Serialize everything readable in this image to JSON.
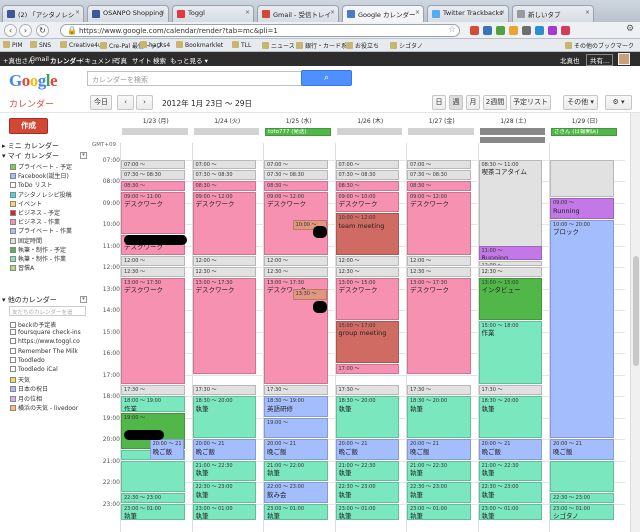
{
  "browser": {
    "tabs": [
      {
        "label": "(2) 「アシタノレシ",
        "color": "#3b5998",
        "active": false
      },
      {
        "label": "OSANPO Shopping",
        "color": "#3b5998",
        "active": false
      },
      {
        "label": "Toggl",
        "color": "#e0393e",
        "active": false
      },
      {
        "label": "Gmail - 受信トレイ",
        "color": "#d14836",
        "active": false
      },
      {
        "label": "Google カレンダー",
        "color": "#4d79c6",
        "active": true
      },
      {
        "label": "Twitter Trackbacks",
        "color": "#55acee",
        "active": false
      },
      {
        "label": "新しいタブ",
        "color": "#999999",
        "active": false
      }
    ],
    "url": "https://www.google.com/calendar/render?tab=mc&pli=1",
    "bookmarks": [
      "PIM",
      "SNS",
      "Creative4u",
      "Cre-Pal 最優トップ",
      "hacks4",
      "Bookmarklet",
      "TLL",
      "ニュース",
      "銀行・カード系",
      "お役立ち",
      "シゴタノ"
    ],
    "other_bookmarks": "その他のブックマーク"
  },
  "gbar": {
    "items": [
      "+真也さん",
      "Gmail",
      "カレンダー",
      "ドキュメント",
      "写真",
      "サイト",
      "検索",
      "もっと見る ▾"
    ],
    "user": "北真也",
    "share": "共有..."
  },
  "header": {
    "logo": "Google",
    "search_placeholder": "カレンダーを検索"
  },
  "toolbar": {
    "title": "カレンダー",
    "today": "今日",
    "prev": "‹",
    "next": "›",
    "range": "2012年 1月 23日 ～ 29日",
    "views": [
      "日",
      "週",
      "月",
      "2週間",
      "予定リスト"
    ],
    "selected_view": "週",
    "more": "その他 ▾",
    "settings": "⚙ ▾"
  },
  "sidebar": {
    "create": "作成",
    "mini_calendar": "▸ ミニ カレンダー",
    "my_calendars": "▾ マイ カレンダー",
    "my": [
      {
        "name": "プライベート - 予定",
        "color": "#7bd148"
      },
      {
        "name": "Facebook(誕生日)",
        "color": "#a4bdfc"
      },
      {
        "name": "ToDo リスト",
        "color": "#ffffff"
      },
      {
        "name": "アシタノレシピ投稿",
        "color": "#46d6db"
      },
      {
        "name": "イベント",
        "color": "#fbd75b"
      },
      {
        "name": "ビジネス - 予定",
        "color": "#dc2127"
      },
      {
        "name": "ビジネス - 作業",
        "color": "#f691b2"
      },
      {
        "name": "プライベート - 作業",
        "color": "#a4bdfc"
      },
      {
        "name": "固定時間",
        "color": "#e1e1e1"
      },
      {
        "name": "執筆・制作 - 予定",
        "color": "#51b749"
      },
      {
        "name": "執筆・制作 - 作業",
        "color": "#7ae7bf"
      },
      {
        "name": "習慣A",
        "color": "#b3dc6c"
      }
    ],
    "other_calendars": "▾ 他のカレンダー",
    "add_placeholder": "友だちのカレンダーを追",
    "other": [
      {
        "name": "beckの予定表",
        "color": "#ffffff"
      },
      {
        "name": "foursquare check-ins",
        "color": "#ffffff"
      },
      {
        "name": "https://www.toggl.co",
        "color": "#ffffff"
      },
      {
        "name": "Remember The Milk",
        "color": "#ffffff"
      },
      {
        "name": "Toodledo",
        "color": "#ffffff"
      },
      {
        "name": "Toodledo iCal",
        "color": "#ffffff"
      },
      {
        "name": "天気",
        "color": "#fbd75b"
      },
      {
        "name": "日本の祝日",
        "color": "#a4bdfc"
      },
      {
        "name": "月の位相",
        "color": "#dbadff"
      },
      {
        "name": "横浜の天気 - livedoor",
        "color": "#ffb878"
      }
    ]
  },
  "grid": {
    "tz": "GMT+09",
    "days": [
      "1/23 (月)",
      "1/24 (火)",
      "1/25 (水)",
      "1/26 (木)",
      "1/27 (金)",
      "1/28 (土)",
      "1/29 (日)"
    ],
    "allday": [
      {
        "day": 2,
        "label": "toto777 (発送)",
        "color": "#51b749"
      },
      {
        "day": 6,
        "label": "さきん (日報開店)",
        "color": "#51b749"
      }
    ],
    "hours": [
      "07:00",
      "08:00",
      "09:00",
      "10:00",
      "11:00",
      "12:00",
      "13:00",
      "14:00",
      "15:00",
      "16:00",
      "17:00",
      "18:00",
      "19:00",
      "20:00",
      "21:00",
      "22:00",
      "23:00"
    ],
    "events": [
      {
        "day": 0,
        "s": 7.0,
        "e": 7.5,
        "time": "07:00 ～",
        "title": "行く準備",
        "color": "#e1e1e1"
      },
      {
        "day": 0,
        "s": 7.5,
        "e": 8.0,
        "time": "07:30 ～ 08:30",
        "title": "通勤",
        "color": "#e1e1e1"
      },
      {
        "day": 0,
        "s": 8.0,
        "e": 8.5,
        "time": "08:30 ～",
        "title": "日次計画(メー",
        "color": "#f691b2"
      },
      {
        "day": 0,
        "s": 8.5,
        "e": 10.5,
        "time": "09:00 ～ 11:00",
        "title": "デスクワーク",
        "color": "#f691b2"
      },
      {
        "day": 0,
        "s": 10.5,
        "e": 11.5,
        "time": "11:00 ～ 12:00",
        "title": "デスクワーク",
        "color": "#f691b2"
      },
      {
        "day": 0,
        "s": 11.5,
        "e": 12.0,
        "time": "12:00 ～",
        "title": "昼飯",
        "color": "#e1e1e1"
      },
      {
        "day": 0,
        "s": 12.0,
        "e": 12.5,
        "time": "12:30 ～",
        "title": "昼寝",
        "color": "#e1e1e1"
      },
      {
        "day": 0,
        "s": 12.5,
        "e": 17.5,
        "time": "13:00 ～ 17:30",
        "title": "デスクワーク",
        "color": "#f691b2"
      },
      {
        "day": 0,
        "s": 17.5,
        "e": 18.0,
        "time": "17:30 ～",
        "title": "移動",
        "color": "#e1e1e1"
      },
      {
        "day": 0,
        "s": 18.0,
        "e": 18.8,
        "time": "18:00 ～ 19:00",
        "title": "作業",
        "color": "#7ae7bf"
      },
      {
        "day": 0,
        "s": 18.8,
        "e": 20.5,
        "time": "19:00 ～",
        "title": "",
        "color": "#51b749"
      },
      {
        "day": 0,
        "s": 20.5,
        "e": 21.0,
        "time": "",
        "title": "",
        "color": "#7ae7bf"
      },
      {
        "day": 0,
        "s": 21.0,
        "e": 22.5,
        "time": "",
        "title": "",
        "color": "#7ae7bf"
      },
      {
        "day": 0,
        "s": 22.5,
        "e": 23.0,
        "time": "22:30 ～ 23:00",
        "title": "執筆",
        "color": "#7ae7bf"
      },
      {
        "day": 0,
        "s": 23.0,
        "e": 23.8,
        "time": "23:00 ～ 01:00",
        "title": "執筆",
        "color": "#7ae7bf"
      },
      {
        "day": 0,
        "s": 20.0,
        "e": 21.0,
        "time": "20:00 ～ 21",
        "title": "晩ご飯",
        "color": "#a4bdfc",
        "half": true
      },
      {
        "day": 1,
        "s": 7.0,
        "e": 7.5,
        "time": "07:00 ～",
        "title": "行く準備",
        "color": "#e1e1e1"
      },
      {
        "day": 1,
        "s": 7.5,
        "e": 8.0,
        "time": "07:30 ～ 08:30",
        "title": "通勤",
        "color": "#e1e1e1"
      },
      {
        "day": 1,
        "s": 8.0,
        "e": 8.5,
        "time": "08:30 ～",
        "title": "日次計画(メー",
        "color": "#f691b2"
      },
      {
        "day": 1,
        "s": 8.5,
        "e": 11.5,
        "time": "09:00 ～ 12:00",
        "title": "デスクワーク",
        "color": "#f691b2"
      },
      {
        "day": 1,
        "s": 11.5,
        "e": 12.0,
        "time": "12:00 ～",
        "title": "昼飯",
        "color": "#e1e1e1"
      },
      {
        "day": 1,
        "s": 12.0,
        "e": 12.5,
        "time": "12:30 ～",
        "title": "昼寝",
        "color": "#e1e1e1"
      },
      {
        "day": 1,
        "s": 12.5,
        "e": 17.0,
        "time": "13:00 ～ 17:30",
        "title": "デスクワーク",
        "color": "#f691b2"
      },
      {
        "day": 1,
        "s": 17.5,
        "e": 18.0,
        "time": "17:30 ～",
        "title": "移動",
        "color": "#e1e1e1"
      },
      {
        "day": 1,
        "s": 18.0,
        "e": 20.0,
        "time": "18:30 ～ 20:00",
        "title": "執筆",
        "color": "#7ae7bf"
      },
      {
        "day": 1,
        "s": 20.0,
        "e": 21.0,
        "time": "20:00 ～ 21",
        "title": "晩ご飯",
        "color": "#a4bdfc"
      },
      {
        "day": 1,
        "s": 21.0,
        "e": 22.0,
        "time": "21:00 ～ 22:30",
        "title": "執筆",
        "color": "#7ae7bf"
      },
      {
        "day": 1,
        "s": 22.0,
        "e": 23.0,
        "time": "22:30 ～ 23:00",
        "title": "執筆",
        "color": "#7ae7bf"
      },
      {
        "day": 1,
        "s": 23.0,
        "e": 23.8,
        "time": "23:00 ～ 01:00",
        "title": "執筆",
        "color": "#7ae7bf"
      },
      {
        "day": 2,
        "s": 7.0,
        "e": 7.5,
        "time": "07:00 ～",
        "title": "行く準備",
        "color": "#e1e1e1"
      },
      {
        "day": 2,
        "s": 7.5,
        "e": 8.0,
        "time": "07:30 ～ 08:30",
        "title": "通勤",
        "color": "#e1e1e1"
      },
      {
        "day": 2,
        "s": 8.0,
        "e": 8.5,
        "time": "08:30 ～",
        "title": "日次計画(メー",
        "color": "#f691b2"
      },
      {
        "day": 2,
        "s": 8.5,
        "e": 11.5,
        "time": "09:00 ～ 12:00",
        "title": "デスクワーク",
        "color": "#f691b2"
      },
      {
        "day": 2,
        "s": 9.8,
        "e": 10.3,
        "time": "10:00 ～",
        "title": "",
        "color": "#e1977f",
        "half": true
      },
      {
        "day": 2,
        "s": 11.5,
        "e": 12.0,
        "time": "12:00 ～",
        "title": "昼飯",
        "color": "#e1e1e1"
      },
      {
        "day": 2,
        "s": 12.0,
        "e": 12.5,
        "time": "12:30 ～",
        "title": "昼寝",
        "color": "#e1e1e1"
      },
      {
        "day": 2,
        "s": 12.5,
        "e": 17.5,
        "time": "13:00 ～ 17:30",
        "title": "デスクワーク",
        "color": "#f691b2"
      },
      {
        "day": 2,
        "s": 13.0,
        "e": 13.6,
        "time": "13:30 ～",
        "title": "",
        "color": "#e1977f",
        "half": true
      },
      {
        "day": 2,
        "s": 17.5,
        "e": 18.0,
        "time": "17:30 ～",
        "title": "移動",
        "color": "#e1e1e1"
      },
      {
        "day": 2,
        "s": 18.0,
        "e": 19.0,
        "time": "18:30 ～ 19:00",
        "title": "英語研修",
        "color": "#a4bdfc"
      },
      {
        "day": 2,
        "s": 19.0,
        "e": 20.0,
        "time": "19:00 ～",
        "title": "",
        "color": "#a4bdfc"
      },
      {
        "day": 2,
        "s": 20.0,
        "e": 21.0,
        "time": "20:00 ～ 21",
        "title": "晩ご飯",
        "color": "#a4bdfc"
      },
      {
        "day": 2,
        "s": 21.0,
        "e": 22.0,
        "time": "21:00 ～ 22:00",
        "title": "執筆",
        "color": "#7ae7bf"
      },
      {
        "day": 2,
        "s": 22.0,
        "e": 23.0,
        "time": "22:00 ～ 23:00",
        "title": "飲み会",
        "color": "#a4bdfc"
      },
      {
        "day": 2,
        "s": 23.0,
        "e": 23.8,
        "time": "23:00 ～ 01:00",
        "title": "執筆",
        "color": "#7ae7bf"
      },
      {
        "day": 3,
        "s": 7.0,
        "e": 7.5,
        "time": "07:00 ～",
        "title": "行く準備",
        "color": "#e1e1e1"
      },
      {
        "day": 3,
        "s": 7.5,
        "e": 8.0,
        "time": "07:30 ～ 08:30",
        "title": "通勤",
        "color": "#e1e1e1"
      },
      {
        "day": 3,
        "s": 8.0,
        "e": 8.5,
        "time": "08:30 ～",
        "title": "日次計画(メー",
        "color": "#f691b2"
      },
      {
        "day": 3,
        "s": 8.5,
        "e": 9.5,
        "time": "09:00 ～ 10:00",
        "title": "デスクワーク",
        "color": "#f691b2"
      },
      {
        "day": 3,
        "s": 9.5,
        "e": 11.5,
        "time": "10:00 ～ 12:00",
        "title": "team meeting",
        "color": "#d06b64"
      },
      {
        "day": 3,
        "s": 11.5,
        "e": 12.0,
        "time": "12:00 ～",
        "title": "昼飯",
        "color": "#e1e1e1"
      },
      {
        "day": 3,
        "s": 12.0,
        "e": 12.5,
        "time": "12:30 ～",
        "title": "昼寝",
        "color": "#e1e1e1"
      },
      {
        "day": 3,
        "s": 12.5,
        "e": 14.5,
        "time": "13:00 ～ 15:00",
        "title": "デスクワーク",
        "color": "#f691b2"
      },
      {
        "day": 3,
        "s": 14.5,
        "e": 16.5,
        "time": "15:00 ～ 17:00",
        "title": "group meeting",
        "color": "#d06b64"
      },
      {
        "day": 3,
        "s": 16.5,
        "e": 17.0,
        "time": "17:00 ～",
        "title": "デスクワーク",
        "color": "#f691b2"
      },
      {
        "day": 3,
        "s": 17.5,
        "e": 18.0,
        "time": "17:30 ～",
        "title": "移動",
        "color": "#e1e1e1"
      },
      {
        "day": 3,
        "s": 18.0,
        "e": 20.0,
        "time": "18:30 ～ 20:00",
        "title": "執筆",
        "color": "#7ae7bf"
      },
      {
        "day": 3,
        "s": 20.0,
        "e": 21.0,
        "time": "20:00 ～ 21",
        "title": "晩ご飯",
        "color": "#a4bdfc"
      },
      {
        "day": 3,
        "s": 21.0,
        "e": 22.0,
        "time": "21:00 ～ 22:30",
        "title": "執筆",
        "color": "#7ae7bf"
      },
      {
        "day": 3,
        "s": 22.0,
        "e": 23.0,
        "time": "22:30 ～ 23:00",
        "title": "執筆",
        "color": "#7ae7bf"
      },
      {
        "day": 3,
        "s": 23.0,
        "e": 23.8,
        "time": "23:00 ～ 01:00",
        "title": "執筆",
        "color": "#7ae7bf"
      },
      {
        "day": 4,
        "s": 7.0,
        "e": 7.5,
        "time": "07:00 ～",
        "title": "行く準備",
        "color": "#e1e1e1"
      },
      {
        "day": 4,
        "s": 7.5,
        "e": 8.0,
        "time": "07:30 ～ 08:30",
        "title": "通勤",
        "color": "#e1e1e1"
      },
      {
        "day": 4,
        "s": 8.0,
        "e": 8.5,
        "time": "08:30 ～",
        "title": "日次計画(メー",
        "color": "#f691b2"
      },
      {
        "day": 4,
        "s": 8.5,
        "e": 11.5,
        "time": "09:00 ～ 12:00",
        "title": "デスクワーク",
        "color": "#f691b2"
      },
      {
        "day": 4,
        "s": 11.5,
        "e": 12.0,
        "time": "12:00 ～",
        "title": "昼飯",
        "color": "#e1e1e1"
      },
      {
        "day": 4,
        "s": 12.0,
        "e": 12.5,
        "time": "12:30 ～",
        "title": "昼寝",
        "color": "#e1e1e1"
      },
      {
        "day": 4,
        "s": 12.5,
        "e": 17.0,
        "time": "13:00 ～ 17:30",
        "title": "デスクワーク",
        "color": "#f691b2"
      },
      {
        "day": 4,
        "s": 17.5,
        "e": 18.0,
        "time": "17:30 ～",
        "title": "移動",
        "color": "#e1e1e1"
      },
      {
        "day": 4,
        "s": 18.0,
        "e": 20.0,
        "time": "18:30 ～ 20:00",
        "title": "執筆",
        "color": "#7ae7bf"
      },
      {
        "day": 4,
        "s": 20.0,
        "e": 21.0,
        "time": "20:00 ～ 21",
        "title": "晩ご飯",
        "color": "#a4bdfc"
      },
      {
        "day": 4,
        "s": 21.0,
        "e": 22.0,
        "time": "21:00 ～ 22:30",
        "title": "執筆",
        "color": "#7ae7bf"
      },
      {
        "day": 4,
        "s": 22.0,
        "e": 23.0,
        "time": "22:30 ～ 23:00",
        "title": "執筆",
        "color": "#7ae7bf"
      },
      {
        "day": 4,
        "s": 23.0,
        "e": 23.8,
        "time": "23:00 ～ 01:00",
        "title": "執筆",
        "color": "#7ae7bf"
      },
      {
        "day": 5,
        "s": 7.0,
        "e": 11.5,
        "time": "08:30 ～ 11:00",
        "title": "喫茶コアタイム",
        "color": "#e1e1e1"
      },
      {
        "day": 5,
        "s": 11.0,
        "e": 11.7,
        "time": "11:00 ～",
        "title": "Running",
        "color": "#c278e7"
      },
      {
        "day": 5,
        "s": 11.7,
        "e": 12.0,
        "time": "12:00 ～",
        "title": "昼飯",
        "color": "#e1e1e1"
      },
      {
        "day": 5,
        "s": 12.0,
        "e": 12.5,
        "time": "12:30 ～",
        "title": "昼寝",
        "color": "#e1e1e1"
      },
      {
        "day": 5,
        "s": 12.5,
        "e": 14.5,
        "time": "13:00 ～ 15:00",
        "title": "インタビュー",
        "color": "#51b749"
      },
      {
        "day": 5,
        "s": 14.5,
        "e": 17.5,
        "time": "15:00 ～ 18:00",
        "title": "作業",
        "color": "#7ae7bf"
      },
      {
        "day": 5,
        "s": 17.5,
        "e": 18.0,
        "time": "17:30 ～",
        "title": "移動",
        "color": "#e1e1e1"
      },
      {
        "day": 5,
        "s": 18.0,
        "e": 20.0,
        "time": "18:30 ～ 20:00",
        "title": "執筆",
        "color": "#7ae7bf"
      },
      {
        "day": 5,
        "s": 20.0,
        "e": 21.0,
        "time": "20:00 ～ 21",
        "title": "晩ご飯",
        "color": "#a4bdfc"
      },
      {
        "day": 5,
        "s": 21.0,
        "e": 22.0,
        "time": "21:00 ～ 22:30",
        "title": "執筆",
        "color": "#7ae7bf"
      },
      {
        "day": 5,
        "s": 22.0,
        "e": 23.0,
        "time": "22:30 ～ 23:00",
        "title": "執筆",
        "color": "#7ae7bf"
      },
      {
        "day": 5,
        "s": 23.0,
        "e": 23.8,
        "time": "23:00 ～ 01:00",
        "title": "執筆",
        "color": "#7ae7bf"
      },
      {
        "day": 6,
        "s": 7.0,
        "e": 8.8,
        "time": "",
        "title": "",
        "color": "#e1e1e1"
      },
      {
        "day": 6,
        "s": 8.8,
        "e": 9.8,
        "time": "09:00 ～",
        "title": "Running",
        "color": "#c278e7"
      },
      {
        "day": 6,
        "s": 9.8,
        "e": 20.0,
        "time": "10:00 ～ 20:00",
        "title": "ブロック",
        "color": "#a4bdfc"
      },
      {
        "day": 6,
        "s": 20.0,
        "e": 21.0,
        "time": "20:00 ～ 21",
        "title": "晩ご飯",
        "color": "#a4bdfc"
      },
      {
        "day": 6,
        "s": 21.0,
        "e": 22.5,
        "time": "",
        "title": "",
        "color": "#7ae7bf"
      },
      {
        "day": 6,
        "s": 22.5,
        "e": 23.0,
        "time": "22:30 ～ 23:00",
        "title": "執筆",
        "color": "#7ae7bf"
      },
      {
        "day": 6,
        "s": 23.0,
        "e": 23.8,
        "time": "23:00 ～ 01:00",
        "title": "シゴタノ",
        "color": "#7ae7bf"
      }
    ]
  }
}
